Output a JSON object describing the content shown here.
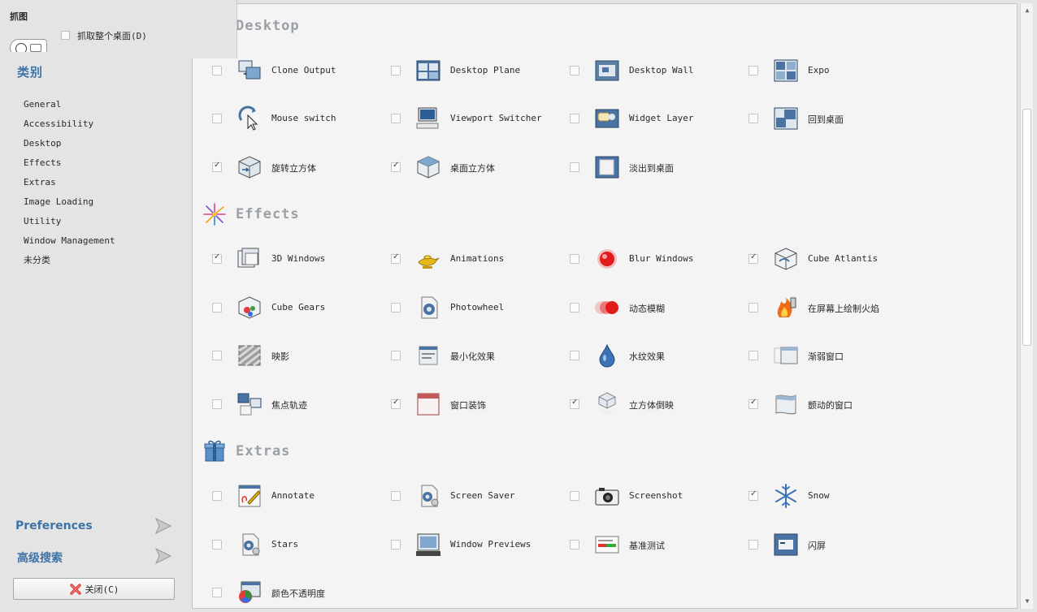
{
  "snap_dialog": {
    "title": "抓图",
    "grab_desktop_label": "抓取整个桌面(D)"
  },
  "sidebar": {
    "heading": "类别",
    "categories": [
      "General",
      "Accessibility",
      "Desktop",
      "Effects",
      "Extras",
      "Image Loading",
      "Utility",
      "Window Management",
      "未分类"
    ],
    "preferences_label": "Preferences",
    "advanced_search_label": "高级搜索",
    "close_label": "关闭(C)"
  },
  "sections": [
    {
      "title": "Desktop",
      "plugins": [
        {
          "label": "Clone Output",
          "checked": false,
          "icon": "clone-output-icon"
        },
        {
          "label": "Desktop Plane",
          "checked": false,
          "icon": "desktop-plane-icon"
        },
        {
          "label": "Desktop Wall",
          "checked": false,
          "icon": "desktop-wall-icon"
        },
        {
          "label": "Expo",
          "checked": false,
          "icon": "expo-icon"
        },
        {
          "label": "Mouse switch",
          "checked": false,
          "icon": "mouse-switch-icon"
        },
        {
          "label": "Viewport Switcher",
          "checked": false,
          "icon": "viewport-switcher-icon"
        },
        {
          "label": "Widget Layer",
          "checked": false,
          "icon": "widget-layer-icon"
        },
        {
          "label": "回到桌面",
          "checked": false,
          "icon": "show-desktop-icon"
        },
        {
          "label": "旋转立方体",
          "checked": true,
          "icon": "rotate-cube-icon"
        },
        {
          "label": "桌面立方体",
          "checked": true,
          "icon": "desktop-cube-icon"
        },
        {
          "label": "淡出到桌面",
          "checked": false,
          "icon": "fade-desktop-icon"
        }
      ]
    },
    {
      "title": "Effects",
      "plugins": [
        {
          "label": "3D Windows",
          "checked": true,
          "icon": "3d-windows-icon"
        },
        {
          "label": "Animations",
          "checked": true,
          "icon": "animations-lamp-icon"
        },
        {
          "label": "Blur Windows",
          "checked": false,
          "icon": "blur-windows-icon"
        },
        {
          "label": "Cube Atlantis",
          "checked": true,
          "icon": "cube-atlantis-icon"
        },
        {
          "label": "Cube Gears",
          "checked": false,
          "icon": "cube-gears-icon"
        },
        {
          "label": "Photowheel",
          "checked": false,
          "icon": "photowheel-icon"
        },
        {
          "label": "动态模糊",
          "checked": false,
          "icon": "motion-blur-icon"
        },
        {
          "label": "在屏幕上绘制火焰",
          "checked": false,
          "icon": "draw-fire-icon"
        },
        {
          "label": "映影",
          "checked": false,
          "icon": "reflection-icon"
        },
        {
          "label": "最小化效果",
          "checked": false,
          "icon": "minimize-effect-icon"
        },
        {
          "label": "水纹效果",
          "checked": false,
          "icon": "water-drop-icon"
        },
        {
          "label": "渐弱窗口",
          "checked": false,
          "icon": "fading-windows-icon"
        },
        {
          "label": "焦点轨迹",
          "checked": false,
          "icon": "focus-trail-icon"
        },
        {
          "label": "窗口装饰",
          "checked": true,
          "icon": "window-decoration-icon"
        },
        {
          "label": "立方体倒映",
          "checked": true,
          "icon": "cube-reflection-icon"
        },
        {
          "label": "颤动的窗口",
          "checked": true,
          "icon": "wobbly-windows-icon"
        }
      ]
    },
    {
      "title": "Extras",
      "plugins": [
        {
          "label": "Annotate",
          "checked": false,
          "icon": "annotate-icon"
        },
        {
          "label": "Screen Saver",
          "checked": false,
          "icon": "screen-saver-icon"
        },
        {
          "label": "Screenshot",
          "checked": false,
          "icon": "camera-icon"
        },
        {
          "label": "Snow",
          "checked": true,
          "icon": "snowflake-icon"
        },
        {
          "label": "Stars",
          "checked": false,
          "icon": "stars-icon"
        },
        {
          "label": "Window Previews",
          "checked": false,
          "icon": "window-previews-icon"
        },
        {
          "label": "基准测试",
          "checked": false,
          "icon": "benchmark-icon"
        },
        {
          "label": "闪屏",
          "checked": false,
          "icon": "splash-icon"
        },
        {
          "label": "颜色不透明度",
          "checked": false,
          "icon": "color-opacity-icon"
        }
      ]
    }
  ]
}
